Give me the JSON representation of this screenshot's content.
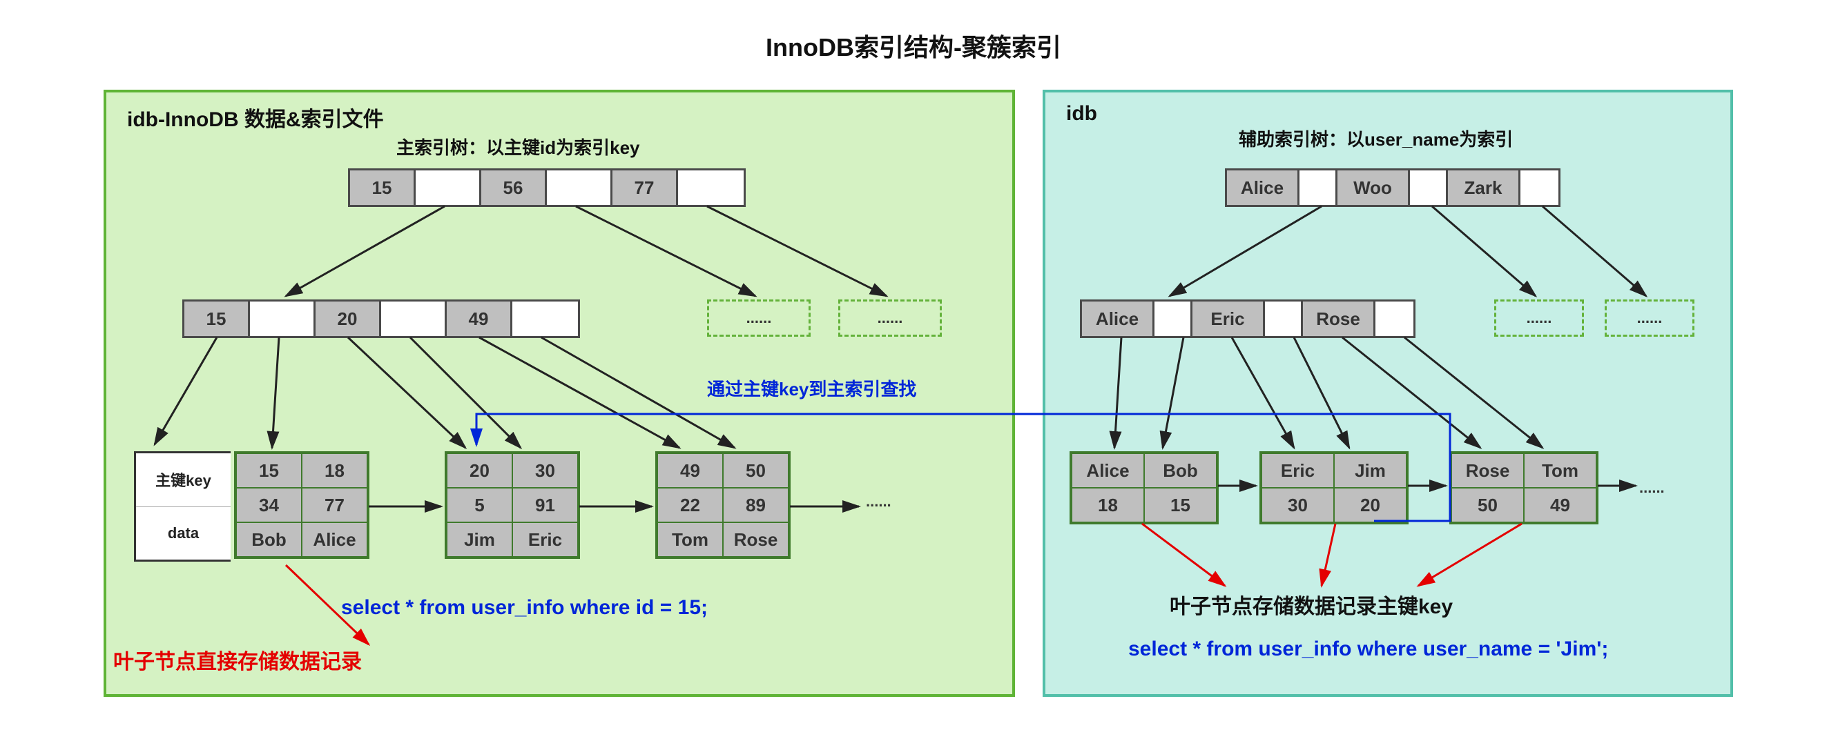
{
  "title": "InnoDB索引结构-聚簇索引",
  "left": {
    "panel_title": "idb-InnoDB 数据&索引文件",
    "subtitle": "主索引树：以主键id为索引key",
    "root_keys": [
      "15",
      "56",
      "77"
    ],
    "mid_keys": [
      "15",
      "20",
      "49"
    ],
    "ghost": "......",
    "leaf_label_key": "主键key",
    "leaf_label_data": "data",
    "leaf1": [
      "15",
      "18",
      "34",
      "77",
      "Bob",
      "Alice"
    ],
    "leaf2": [
      "20",
      "30",
      "5",
      "91",
      "Jim",
      "Eric"
    ],
    "leaf3": [
      "49",
      "50",
      "22",
      "89",
      "Tom",
      "Rose"
    ],
    "leaf_ellipsis": "......",
    "note_red": "叶子节点直接存储数据记录",
    "note_blue_path": "通过主键key到主索引查找",
    "sql": "select  * from user_info  where id = 15;"
  },
  "right": {
    "panel_title": "idb",
    "subtitle": "辅助索引树：以user_name为索引",
    "root_keys": [
      "Alice",
      "Woo",
      "Zark"
    ],
    "mid_keys": [
      "Alice",
      "Eric",
      "Rose"
    ],
    "ghost": "......",
    "leaf1": [
      "Alice",
      "Bob",
      "18",
      "15"
    ],
    "leaf2": [
      "Eric",
      "Jim",
      "30",
      "20"
    ],
    "leaf3": [
      "Rose",
      "Tom",
      "50",
      "49"
    ],
    "leaf_ellipsis": "......",
    "note_black": "叶子节点存储数据记录主键key",
    "sql": "select  * from user_info  where user_name = 'Jim';"
  }
}
